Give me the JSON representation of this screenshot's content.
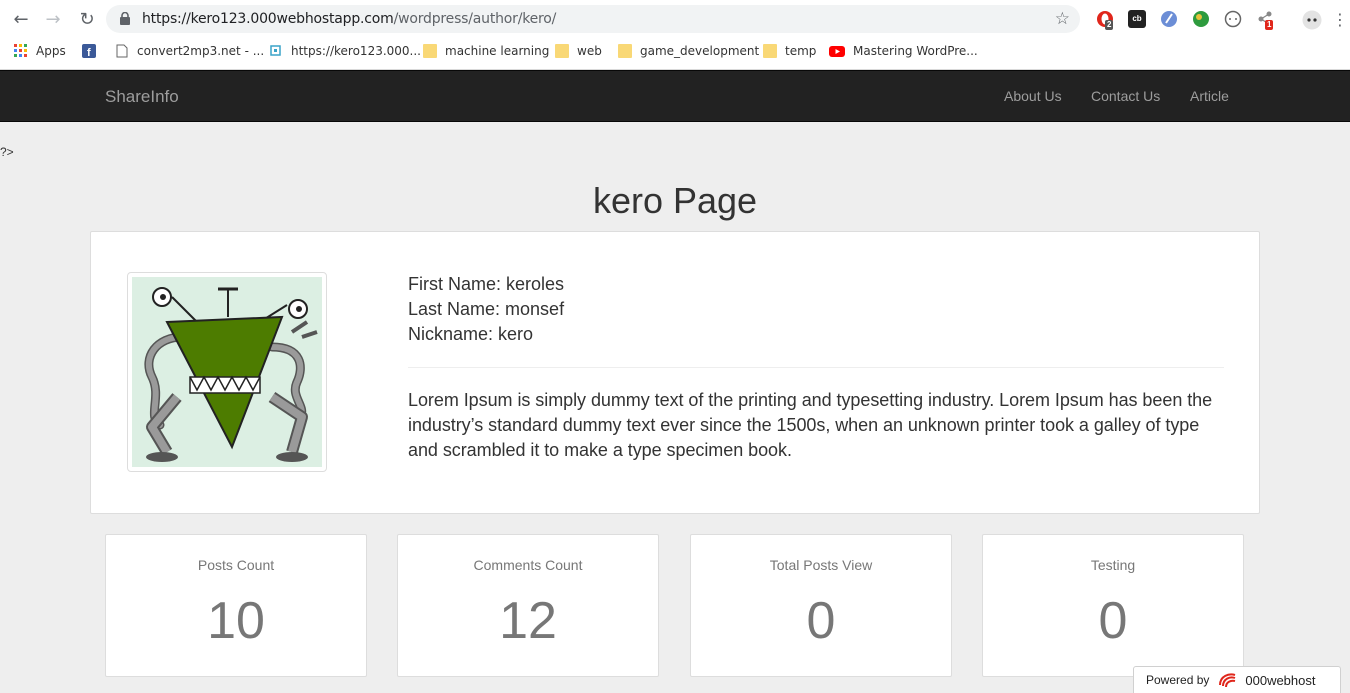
{
  "browser": {
    "url_host": "https://kero123.000webhostapp.com",
    "url_path": "/wordpress/author/kero/",
    "extension_badges": [
      "2",
      "1"
    ],
    "bookmarks": [
      {
        "label": "Apps",
        "icon": "apps-grid-icon"
      },
      {
        "label": "",
        "icon": "facebook-icon"
      },
      {
        "label": "convert2mp3.net - ...",
        "icon": "page-icon"
      },
      {
        "label": "https://kero123.000...",
        "icon": "site-icon"
      },
      {
        "label": "machine learning",
        "icon": "folder-icon"
      },
      {
        "label": "web",
        "icon": "folder-icon"
      },
      {
        "label": "game_development",
        "icon": "folder-icon"
      },
      {
        "label": "temp",
        "icon": "folder-icon"
      },
      {
        "label": "Mastering WordPre...",
        "icon": "youtube-icon"
      }
    ]
  },
  "site": {
    "brand": "ShareInfo",
    "nav": [
      "About Us",
      "Contact Us",
      "Article"
    ],
    "stray_text": "?>",
    "page_title": "kero Page"
  },
  "profile": {
    "first_name": "First Name: keroles",
    "last_name": "Last Name: monsef",
    "nickname": "Nickname: kero",
    "bio": "Lorem Ipsum is simply dummy text of the printing and typesetting industry. Lorem Ipsum has been the industry’s standard dummy text ever since the 1500s, when an unknown printer took a galley of type and scrambled it to make a type specimen book."
  },
  "stats": [
    {
      "title": "Posts Count",
      "value": "10"
    },
    {
      "title": "Comments Count",
      "value": "12"
    },
    {
      "title": "Total Posts View",
      "value": "0"
    },
    {
      "title": "Testing",
      "value": "0"
    }
  ],
  "footer": {
    "powered_by": "Powered by",
    "host_brand": "000webhost"
  },
  "colors": {
    "navbar_bg": "#222222",
    "page_bg": "#eeeeee",
    "avatar_green": "#4d7c00"
  }
}
